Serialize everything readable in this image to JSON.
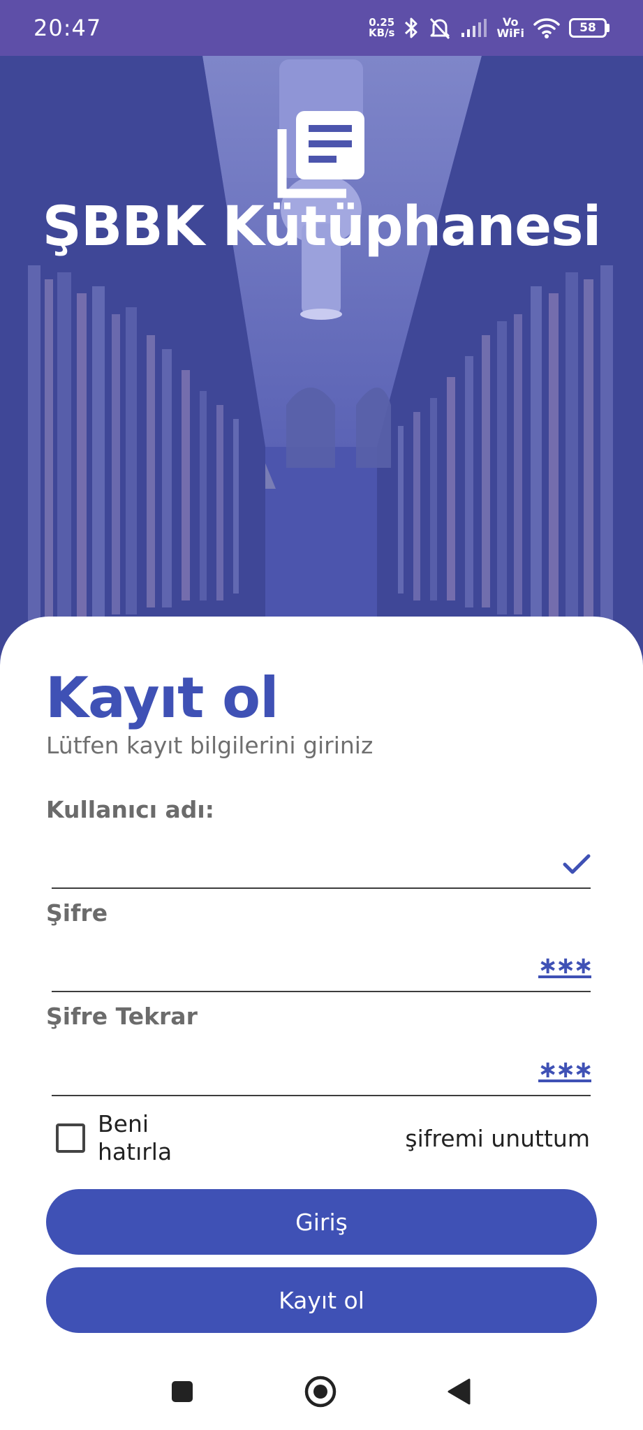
{
  "status_bar": {
    "time": "20:47",
    "net_speed_value": "0.25",
    "net_speed_unit": "KB/s",
    "volte_top": "Vo",
    "volte_bottom": "WiFi",
    "battery": "58"
  },
  "hero": {
    "title": "ŞBBK Kütüphanesi",
    "logo_icon": "library-books-icon",
    "overlay_color": "#4c55ad"
  },
  "form": {
    "title": "Kayıt ol",
    "subtitle": "Lütfen kayıt bilgilerini giriniz",
    "username": {
      "label": "Kullanıcı adı:",
      "value": "",
      "placeholder": "",
      "icon": "check-icon"
    },
    "password": {
      "label": "Şifre",
      "value": "",
      "placeholder": "",
      "icon": "password-icon"
    },
    "password_repeat": {
      "label": "Şifre Tekrar",
      "value": "",
      "placeholder": "",
      "icon": "password-icon"
    },
    "remember_me": {
      "label": "Beni hatırla",
      "checked": false
    },
    "forgot_password": "şifremi unuttum",
    "login_button": "Giriş",
    "register_button": "Kayıt ol"
  },
  "colors": {
    "primary": "#3f51b5",
    "status_bar": "#5e4fa8"
  },
  "nav_bar": {
    "recents_icon": "square-icon",
    "home_icon": "circle-home-icon",
    "back_icon": "triangle-back-icon"
  }
}
